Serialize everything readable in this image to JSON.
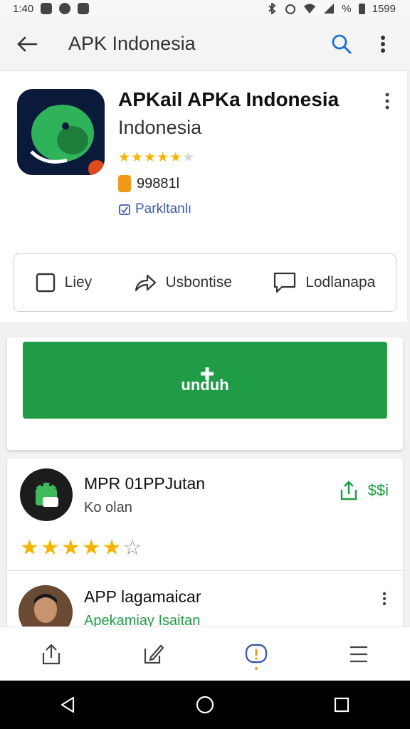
{
  "status_bar": {
    "time": "1:40",
    "battery": "1599"
  },
  "app_bar": {
    "title": "APK Indonesia"
  },
  "app": {
    "title": "APKail APKa Indonesia",
    "subtitle": "Indonesia",
    "rating": 4.5,
    "downloads": "99881l",
    "category": "Parkltanlı"
  },
  "actions": [
    {
      "label": "Liey",
      "icon": "checkbox-icon"
    },
    {
      "label": "Usbontise",
      "icon": "share-arrow-icon"
    },
    {
      "label": "Lodlanapa",
      "icon": "comment-icon"
    }
  ],
  "install": {
    "label": "unduh"
  },
  "list": [
    {
      "title": "MPR 01PPJutan",
      "subtitle": "Ko olan",
      "share_label": "$$i",
      "stars": 5,
      "filled": 5
    },
    {
      "title": "APP lagamaicar",
      "subtitle": "Apekamiay Isaitan"
    }
  ],
  "colors": {
    "accent": "#1f9c45",
    "star": "#f5b400",
    "link": "#3c5aa6",
    "badge": "#f09a1a"
  },
  "bottom_nav": [
    "share-icon",
    "edit-icon",
    "alert-icon",
    "menu-icon"
  ],
  "system_nav": [
    "back-triangle-icon",
    "home-circle-icon",
    "recents-square-icon"
  ]
}
